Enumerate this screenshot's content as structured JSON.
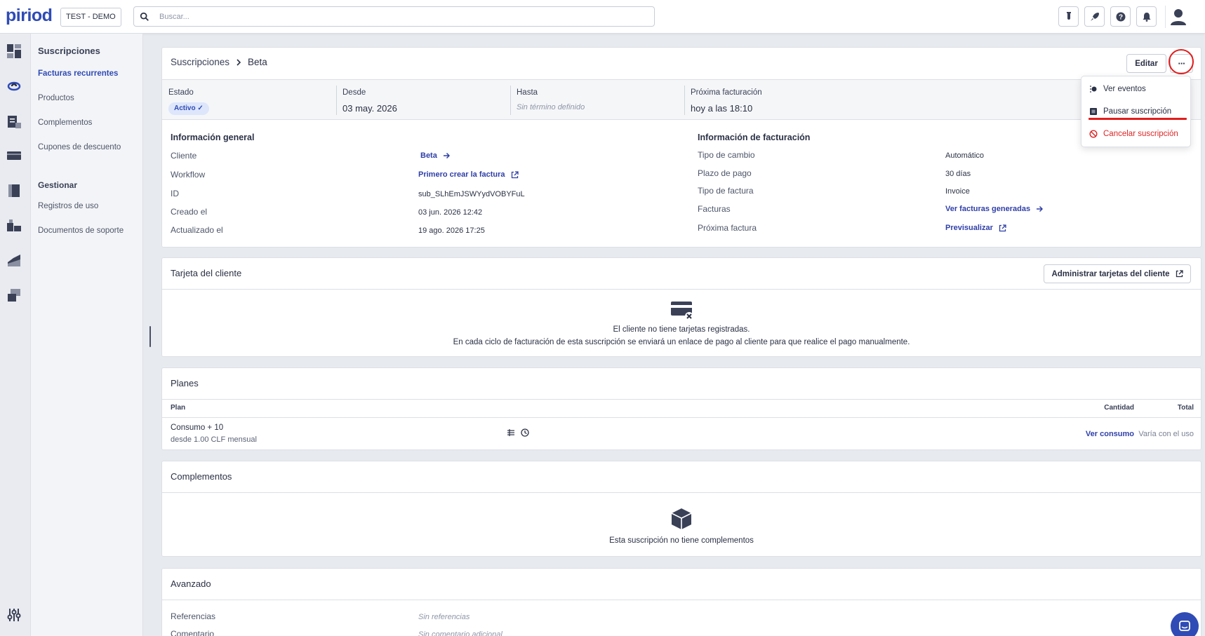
{
  "app": {
    "logo": "piriod",
    "environment": "TEST - DEMO"
  },
  "search": {
    "placeholder": "Buscar..."
  },
  "topbar_icons": [
    "flask-icon",
    "rocket-icon",
    "help-icon",
    "bell-icon",
    "user-icon"
  ],
  "sidenav": {
    "group1": "Suscripciones",
    "items1": [
      "Facturas recurrentes",
      "Productos",
      "Complementos",
      "Cupones de descuento"
    ],
    "group2": "Gestionar",
    "items2": [
      "Registros de uso",
      "Documentos de soporte"
    ]
  },
  "breadcrumb": {
    "parent": "Suscripciones",
    "current": "Beta"
  },
  "header": {
    "edit_label": "Editar",
    "more_label": "···"
  },
  "status": {
    "estado_label": "Estado",
    "estado_value": "Activo ✓",
    "desde_label": "Desde",
    "desde_value": "03 may. 2026",
    "hasta_label": "Hasta",
    "hasta_value": "Sin término definido",
    "proxima_label": "Próxima facturación",
    "proxima_value": "hoy a las 18:10"
  },
  "menu": {
    "ver_eventos": "Ver eventos",
    "pausar": "Pausar suscripción",
    "cancelar": "Cancelar suscripción"
  },
  "general": {
    "title": "Información general",
    "cliente_label": "Cliente",
    "cliente_value": "Beta",
    "workflow_label": "Workflow",
    "workflow_value": "Primero crear la factura",
    "id_label": "ID",
    "id_value": "sub_SLhEmJSWYydVOBYFuL",
    "creado_label": "Creado el",
    "creado_value": "03 jun. 2026 12:42",
    "actualizado_label": "Actualizado el",
    "actualizado_value": "19 ago. 2026 17:25"
  },
  "billing": {
    "title": "Información de facturación",
    "cambio_label": "Tipo de cambio",
    "cambio_value": "Automático",
    "plazo_label": "Plazo de pago",
    "plazo_value": "30 días",
    "tipo_label": "Tipo de factura",
    "tipo_value": "Invoice",
    "facturas_label": "Facturas",
    "facturas_value": "Ver facturas generadas",
    "proxima_label": "Próxima factura",
    "proxima_value": "Previsualizar"
  },
  "card_section": {
    "title": "Tarjeta del cliente",
    "button": "Administrar tarjetas del cliente",
    "empty1": "El cliente no tiene tarjetas registradas.",
    "empty2": "En cada ciclo de facturación de esta suscripción se enviará un enlace de pago al cliente para que realice el pago manualmente."
  },
  "plans": {
    "title": "Planes",
    "col_plan": "Plan",
    "col_cantidad": "Cantidad",
    "col_total": "Total",
    "row_name": "Consumo + 10",
    "row_sub": "desde 1.00 CLF mensual",
    "row_cantidad": "Ver consumo",
    "row_total": "Varía con el uso"
  },
  "addons": {
    "title": "Complementos",
    "empty": "Esta suscripción no tiene complementos"
  },
  "advanced": {
    "title": "Avanzado",
    "ref_label": "Referencias",
    "ref_value": "Sin referencias",
    "com_label": "Comentario",
    "com_value": "Sin comentario adicional"
  },
  "colors": {
    "accent": "#2f4bb5",
    "danger": "#dc2626",
    "annotation": "#e11d1d"
  }
}
